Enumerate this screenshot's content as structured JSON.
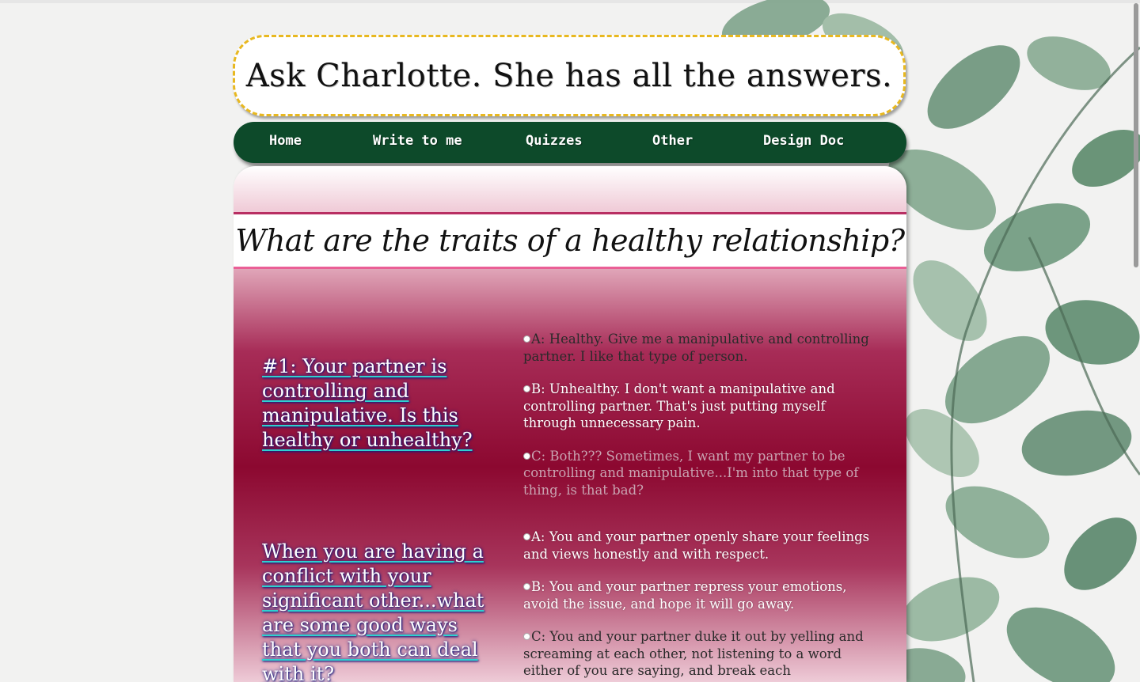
{
  "site": {
    "banner_title": "Ask Charlotte. She has all the answers."
  },
  "nav": {
    "items": [
      {
        "label": "Home"
      },
      {
        "label": "Write to me"
      },
      {
        "label": "Quizzes"
      },
      {
        "label": "Other"
      },
      {
        "label": "Design Doc"
      }
    ]
  },
  "quiz": {
    "title": "What are the traits of a healthy relationship?",
    "questions": [
      {
        "text": "#1: Your partner is controlling and manipulative. Is this healthy or unhealthy?",
        "answers": [
          {
            "label": "A: Healthy. Give me a manipulative and controlling partner. I like that type of person."
          },
          {
            "label": "B: Unhealthy. I don't want a manipulative and controlling partner. That's just putting myself through unnecessary pain."
          },
          {
            "label": "C: Both??? Sometimes, I want my partner to be controlling and manipulative...I'm into that type of thing, is that bad?"
          }
        ]
      },
      {
        "text": "When you are having a conflict with your significant other...what are some good ways that you both can deal with it?",
        "answers": [
          {
            "label": "A: You and your partner openly share your feelings and views honestly and with respect."
          },
          {
            "label": "B: You and your partner repress your emotions, avoid the issue, and hope it will go away."
          },
          {
            "label": "C: You and your partner duke it out by yelling and screaming at each other, not listening to a word either of you are saying, and break each"
          }
        ]
      }
    ]
  },
  "colors": {
    "nav_bg": "#0d4a2a",
    "banner_border": "#e8b820",
    "panel_main": "#8c0830",
    "underline_accent": "#2ed0d0"
  },
  "icons": {
    "background": "eucalyptus-leaves-image"
  }
}
